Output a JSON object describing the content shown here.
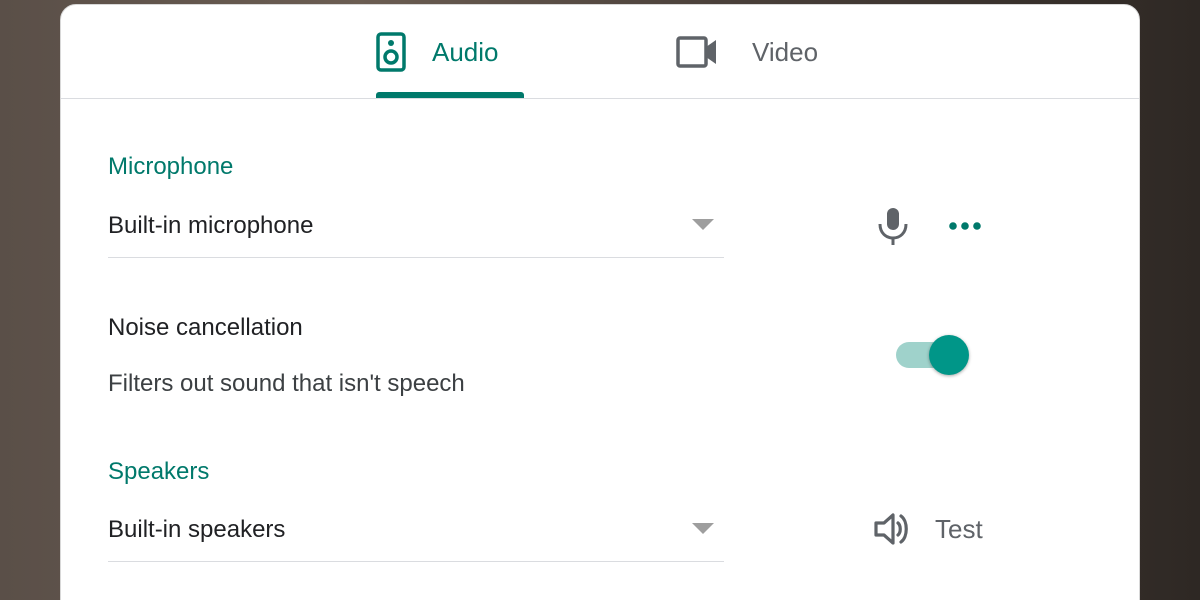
{
  "tabs": [
    {
      "label": "Audio",
      "icon": "speaker-device-icon",
      "selected": true
    },
    {
      "label": "Video",
      "icon": "video-camera-icon",
      "selected": false
    }
  ],
  "microphone": {
    "title": "Microphone",
    "selected": "Built-in microphone",
    "icons": [
      "mic-icon",
      "more-options-icon"
    ]
  },
  "noise_cancellation": {
    "title": "Noise cancellation",
    "description": "Filters out sound that isn't speech",
    "enabled": true
  },
  "speakers": {
    "title": "Speakers",
    "selected": "Built-in speakers",
    "test_label": "Test",
    "icon": "volume-icon"
  },
  "colors": {
    "accent": "#00796b",
    "toggle_thumb": "#009688",
    "toggle_track": "#9fd2cb",
    "text_primary": "#202124",
    "text_secondary": "#5f6368",
    "divider": "#dadce0"
  }
}
